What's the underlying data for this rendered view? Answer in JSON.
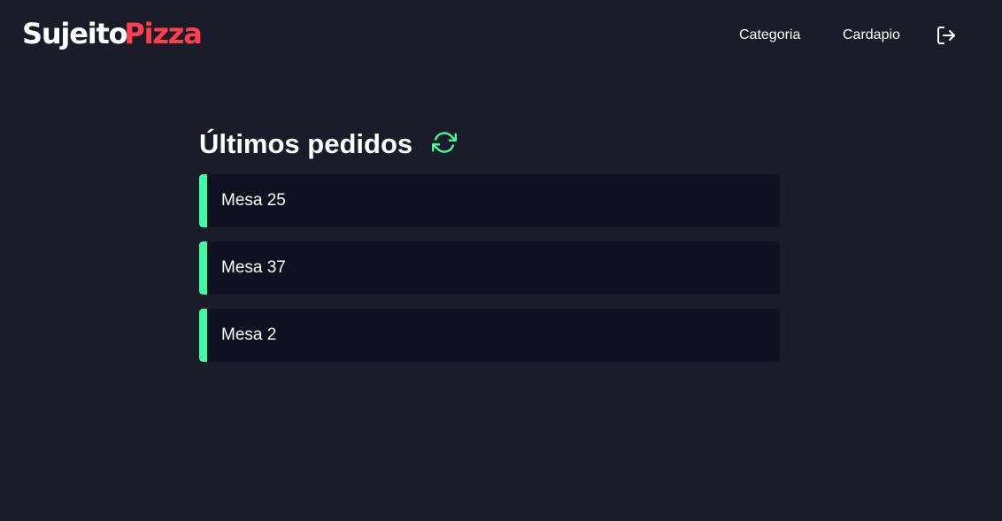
{
  "header": {
    "logo": {
      "part1": "Sujeito",
      "part2": "Pizza"
    },
    "nav": [
      {
        "label": "Categoria"
      },
      {
        "label": "Cardapio"
      }
    ],
    "logout_icon": "logout-icon"
  },
  "main": {
    "title": "Últimos pedidos",
    "refresh_icon": "refresh-icon",
    "orders": [
      {
        "label": "Mesa 25"
      },
      {
        "label": "Mesa 37"
      },
      {
        "label": "Mesa 2"
      }
    ]
  },
  "colors": {
    "background": "#1b1c29",
    "card": "#101120",
    "accent_green": "#3fffa3",
    "brand_red": "#ff3f4b",
    "text": "#ffffff"
  }
}
